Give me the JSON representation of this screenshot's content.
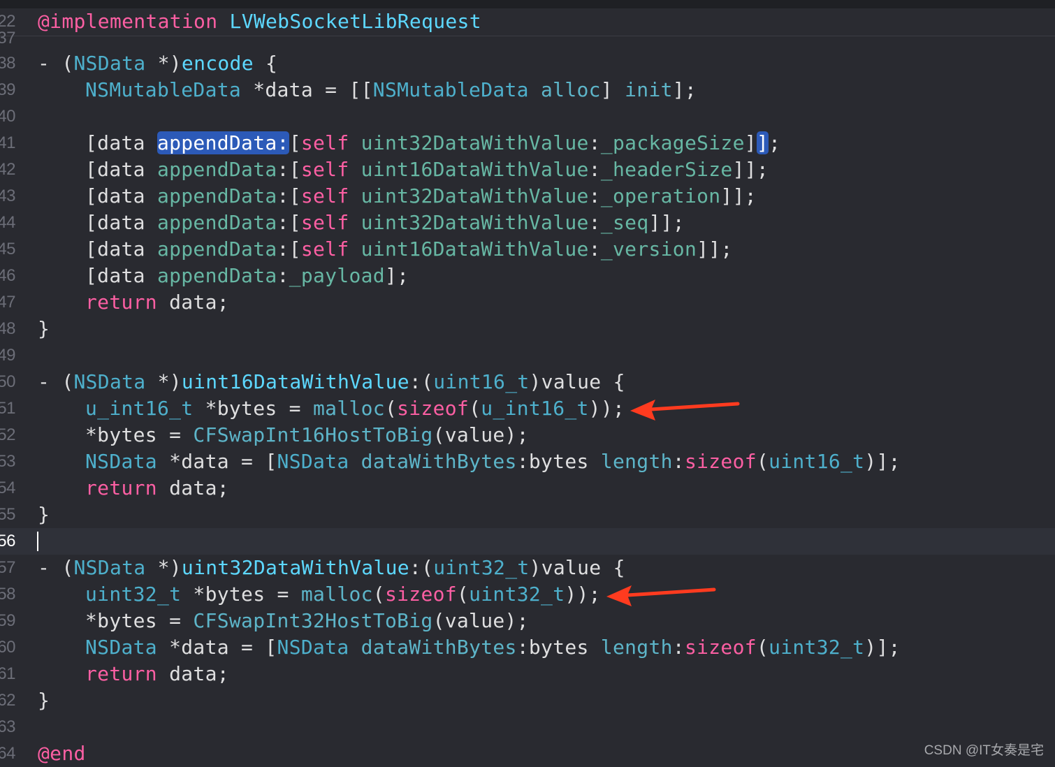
{
  "editor": {
    "file_language": "Objective-C",
    "current_line": "56",
    "header": {
      "line_number": "22",
      "tokens": [
        {
          "t": "@implementation",
          "c": "kw"
        },
        {
          "t": " ",
          "c": "pl"
        },
        {
          "t": "LVWebSocketLibRequest",
          "c": "ty"
        }
      ]
    },
    "lines": [
      {
        "n": "37",
        "indent": 0,
        "tokens": []
      },
      {
        "n": "38",
        "indent": 0,
        "tokens": [
          {
            "t": "- (",
            "c": "pl"
          },
          {
            "t": "NSData",
            "c": "cls"
          },
          {
            "t": " *)",
            "c": "pl"
          },
          {
            "t": "encode",
            "c": "ty"
          },
          {
            "t": " {",
            "c": "pl"
          }
        ]
      },
      {
        "n": "39",
        "indent": 1,
        "tokens": [
          {
            "t": "NSMutableData",
            "c": "cls"
          },
          {
            "t": " *data = [[",
            "c": "pl"
          },
          {
            "t": "NSMutableData",
            "c": "cls"
          },
          {
            "t": " ",
            "c": "pl"
          },
          {
            "t": "alloc",
            "c": "mf"
          },
          {
            "t": "] ",
            "c": "pl"
          },
          {
            "t": "init",
            "c": "mf"
          },
          {
            "t": "];",
            "c": "pl"
          }
        ]
      },
      {
        "n": "40",
        "indent": 0,
        "tokens": []
      },
      {
        "n": "41",
        "indent": 1,
        "tokens": [
          {
            "t": "[data ",
            "c": "pl"
          },
          {
            "t": "appendData:",
            "c": "hl"
          },
          {
            "t": "[",
            "c": "pl"
          },
          {
            "t": "self",
            "c": "kw"
          },
          {
            "t": " ",
            "c": "pl"
          },
          {
            "t": "uint32DataWithValue",
            "c": "fn"
          },
          {
            "t": ":",
            "c": "pl"
          },
          {
            "t": "_packageSize",
            "c": "fn"
          },
          {
            "t": "]",
            "c": "pl"
          },
          {
            "t": "]",
            "c": "hl"
          },
          {
            "t": ";",
            "c": "pl"
          }
        ]
      },
      {
        "n": "42",
        "indent": 1,
        "tokens": [
          {
            "t": "[data ",
            "c": "pl"
          },
          {
            "t": "appendData",
            "c": "fn"
          },
          {
            "t": ":[",
            "c": "pl"
          },
          {
            "t": "self",
            "c": "kw"
          },
          {
            "t": " ",
            "c": "pl"
          },
          {
            "t": "uint16DataWithValue",
            "c": "fn"
          },
          {
            "t": ":",
            "c": "pl"
          },
          {
            "t": "_headerSize",
            "c": "fn"
          },
          {
            "t": "]];",
            "c": "pl"
          }
        ]
      },
      {
        "n": "43",
        "indent": 1,
        "tokens": [
          {
            "t": "[data ",
            "c": "pl"
          },
          {
            "t": "appendData",
            "c": "fn"
          },
          {
            "t": ":[",
            "c": "pl"
          },
          {
            "t": "self",
            "c": "kw"
          },
          {
            "t": " ",
            "c": "pl"
          },
          {
            "t": "uint32DataWithValue",
            "c": "fn"
          },
          {
            "t": ":",
            "c": "pl"
          },
          {
            "t": "_operation",
            "c": "fn"
          },
          {
            "t": "]];",
            "c": "pl"
          }
        ]
      },
      {
        "n": "44",
        "indent": 1,
        "tokens": [
          {
            "t": "[data ",
            "c": "pl"
          },
          {
            "t": "appendData",
            "c": "fn"
          },
          {
            "t": ":[",
            "c": "pl"
          },
          {
            "t": "self",
            "c": "kw"
          },
          {
            "t": " ",
            "c": "pl"
          },
          {
            "t": "uint32DataWithValue",
            "c": "fn"
          },
          {
            "t": ":",
            "c": "pl"
          },
          {
            "t": "_seq",
            "c": "fn"
          },
          {
            "t": "]];",
            "c": "pl"
          }
        ]
      },
      {
        "n": "45",
        "indent": 1,
        "tokens": [
          {
            "t": "[data ",
            "c": "pl"
          },
          {
            "t": "appendData",
            "c": "fn"
          },
          {
            "t": ":[",
            "c": "pl"
          },
          {
            "t": "self",
            "c": "kw"
          },
          {
            "t": " ",
            "c": "pl"
          },
          {
            "t": "uint16DataWithValue",
            "c": "fn"
          },
          {
            "t": ":",
            "c": "pl"
          },
          {
            "t": "_version",
            "c": "fn"
          },
          {
            "t": "]];",
            "c": "pl"
          }
        ]
      },
      {
        "n": "46",
        "indent": 1,
        "tokens": [
          {
            "t": "[data ",
            "c": "pl"
          },
          {
            "t": "appendData",
            "c": "fn"
          },
          {
            "t": ":",
            "c": "pl"
          },
          {
            "t": "_payload",
            "c": "fn"
          },
          {
            "t": "];",
            "c": "pl"
          }
        ]
      },
      {
        "n": "47",
        "indent": 1,
        "tokens": [
          {
            "t": "return",
            "c": "kw"
          },
          {
            "t": " data;",
            "c": "pl"
          }
        ]
      },
      {
        "n": "48",
        "indent": 0,
        "tokens": [
          {
            "t": "}",
            "c": "pl"
          }
        ]
      },
      {
        "n": "49",
        "indent": 0,
        "tokens": []
      },
      {
        "n": "50",
        "indent": 0,
        "tokens": [
          {
            "t": "- (",
            "c": "pl"
          },
          {
            "t": "NSData",
            "c": "cls"
          },
          {
            "t": " *)",
            "c": "pl"
          },
          {
            "t": "uint16DataWithValue",
            "c": "ty"
          },
          {
            "t": ":(",
            "c": "pl"
          },
          {
            "t": "uint16_t",
            "c": "cls"
          },
          {
            "t": ")value {",
            "c": "pl"
          }
        ]
      },
      {
        "n": "51",
        "indent": 1,
        "arrow": true,
        "tokens": [
          {
            "t": "u_int16_t",
            "c": "cls"
          },
          {
            "t": " *bytes = ",
            "c": "pl"
          },
          {
            "t": "malloc",
            "c": "mf"
          },
          {
            "t": "(",
            "c": "pl"
          },
          {
            "t": "sizeof",
            "c": "kw"
          },
          {
            "t": "(",
            "c": "pl"
          },
          {
            "t": "u_int16_t",
            "c": "cls"
          },
          {
            "t": "));",
            "c": "pl"
          }
        ]
      },
      {
        "n": "52",
        "indent": 1,
        "tokens": [
          {
            "t": "*bytes = ",
            "c": "pl"
          },
          {
            "t": "CFSwapInt16HostToBig",
            "c": "mf"
          },
          {
            "t": "(value);",
            "c": "pl"
          }
        ]
      },
      {
        "n": "53",
        "indent": 1,
        "tokens": [
          {
            "t": "NSData",
            "c": "cls"
          },
          {
            "t": " *data = [",
            "c": "pl"
          },
          {
            "t": "NSData",
            "c": "cls"
          },
          {
            "t": " ",
            "c": "pl"
          },
          {
            "t": "dataWithBytes",
            "c": "mf"
          },
          {
            "t": ":bytes ",
            "c": "pl"
          },
          {
            "t": "length",
            "c": "mf"
          },
          {
            "t": ":",
            "c": "pl"
          },
          {
            "t": "sizeof",
            "c": "kw"
          },
          {
            "t": "(",
            "c": "pl"
          },
          {
            "t": "uint16_t",
            "c": "cls"
          },
          {
            "t": ")];",
            "c": "pl"
          }
        ]
      },
      {
        "n": "54",
        "indent": 1,
        "tokens": [
          {
            "t": "return",
            "c": "kw"
          },
          {
            "t": " data;",
            "c": "pl"
          }
        ]
      },
      {
        "n": "55",
        "indent": 0,
        "tokens": [
          {
            "t": "}",
            "c": "pl"
          }
        ]
      },
      {
        "n": "56",
        "indent": 0,
        "current": true,
        "tokens": []
      },
      {
        "n": "57",
        "indent": 0,
        "tokens": [
          {
            "t": "- (",
            "c": "pl"
          },
          {
            "t": "NSData",
            "c": "cls"
          },
          {
            "t": " *)",
            "c": "pl"
          },
          {
            "t": "uint32DataWithValue",
            "c": "ty"
          },
          {
            "t": ":(",
            "c": "pl"
          },
          {
            "t": "uint32_t",
            "c": "cls"
          },
          {
            "t": ")value {",
            "c": "pl"
          }
        ]
      },
      {
        "n": "58",
        "indent": 1,
        "arrow": true,
        "tokens": [
          {
            "t": "uint32_t",
            "c": "cls"
          },
          {
            "t": " *bytes = ",
            "c": "pl"
          },
          {
            "t": "malloc",
            "c": "mf"
          },
          {
            "t": "(",
            "c": "pl"
          },
          {
            "t": "sizeof",
            "c": "kw"
          },
          {
            "t": "(",
            "c": "pl"
          },
          {
            "t": "uint32_t",
            "c": "cls"
          },
          {
            "t": "));",
            "c": "pl"
          }
        ]
      },
      {
        "n": "59",
        "indent": 1,
        "tokens": [
          {
            "t": "*bytes = ",
            "c": "pl"
          },
          {
            "t": "CFSwapInt32HostToBig",
            "c": "mf"
          },
          {
            "t": "(value);",
            "c": "pl"
          }
        ]
      },
      {
        "n": "60",
        "indent": 1,
        "tokens": [
          {
            "t": "NSData",
            "c": "cls"
          },
          {
            "t": " *data = [",
            "c": "pl"
          },
          {
            "t": "NSData",
            "c": "cls"
          },
          {
            "t": " ",
            "c": "pl"
          },
          {
            "t": "dataWithBytes",
            "c": "mf"
          },
          {
            "t": ":bytes ",
            "c": "pl"
          },
          {
            "t": "length",
            "c": "mf"
          },
          {
            "t": ":",
            "c": "pl"
          },
          {
            "t": "sizeof",
            "c": "kw"
          },
          {
            "t": "(",
            "c": "pl"
          },
          {
            "t": "uint32_t",
            "c": "cls"
          },
          {
            "t": ")];",
            "c": "pl"
          }
        ]
      },
      {
        "n": "61",
        "indent": 1,
        "tokens": [
          {
            "t": "return",
            "c": "kw"
          },
          {
            "t": " data;",
            "c": "pl"
          }
        ]
      },
      {
        "n": "62",
        "indent": 0,
        "tokens": [
          {
            "t": "}",
            "c": "pl"
          }
        ]
      },
      {
        "n": "63",
        "indent": 0,
        "tokens": []
      },
      {
        "n": "64",
        "indent": 0,
        "tokens": [
          {
            "t": "@end",
            "c": "kw"
          }
        ]
      }
    ]
  },
  "annotation": {
    "arrow_color": "#ff3b1f"
  },
  "watermark": "CSDN @IT女奏是宅"
}
